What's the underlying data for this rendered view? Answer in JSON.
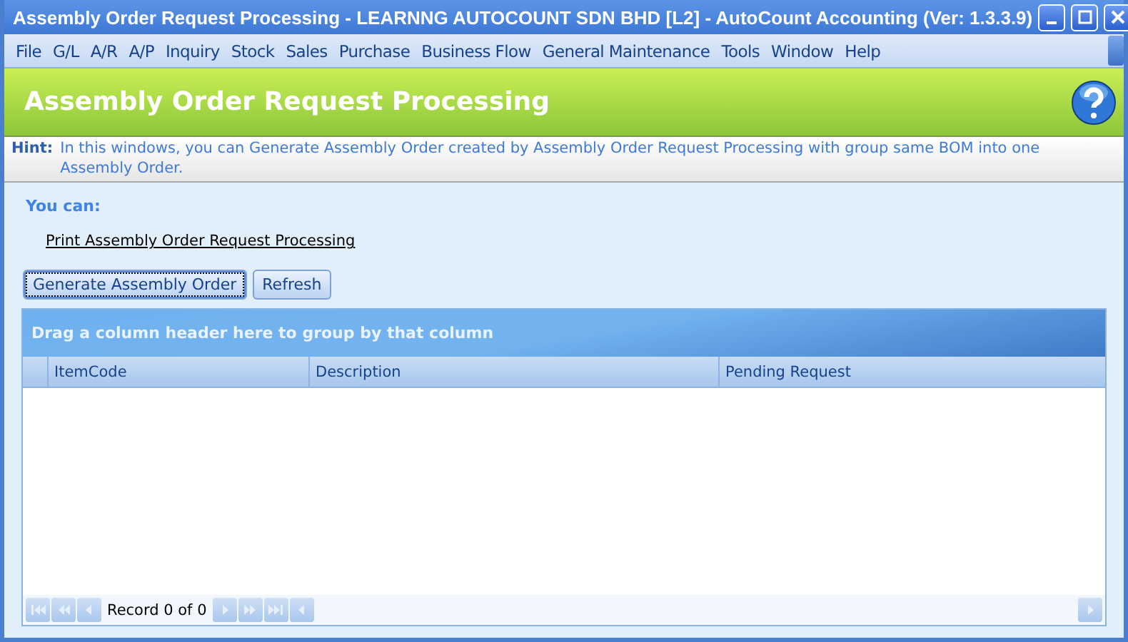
{
  "window": {
    "title": "Assembly Order Request Processing - LEARNNG AUTOCOUNT SDN BHD [L2] - AutoCount Accounting (Ver: 1.3.3.9)"
  },
  "menu": [
    "File",
    "G/L",
    "A/R",
    "A/P",
    "Inquiry",
    "Stock",
    "Sales",
    "Purchase",
    "Business Flow",
    "General Maintenance",
    "Tools",
    "Window",
    "Help"
  ],
  "header": {
    "title": "Assembly Order Request Processing"
  },
  "hint": {
    "label": "Hint:",
    "text": "In this windows, you can Generate Assembly Order created by Assembly Order Request Processing with group same BOM into one Assembly Order."
  },
  "you_can": {
    "label": "You can:",
    "links": [
      "Print Assembly Order Request Processing"
    ]
  },
  "buttons": [
    {
      "label": "Generate Assembly Order",
      "focused": true
    },
    {
      "label": "Refresh",
      "focused": false
    }
  ],
  "grid": {
    "group_panel": "Drag a column header here to group by that column",
    "columns": [
      "ItemCode",
      "Description",
      "Pending Request"
    ],
    "navigator": "Record 0 of 0"
  }
}
